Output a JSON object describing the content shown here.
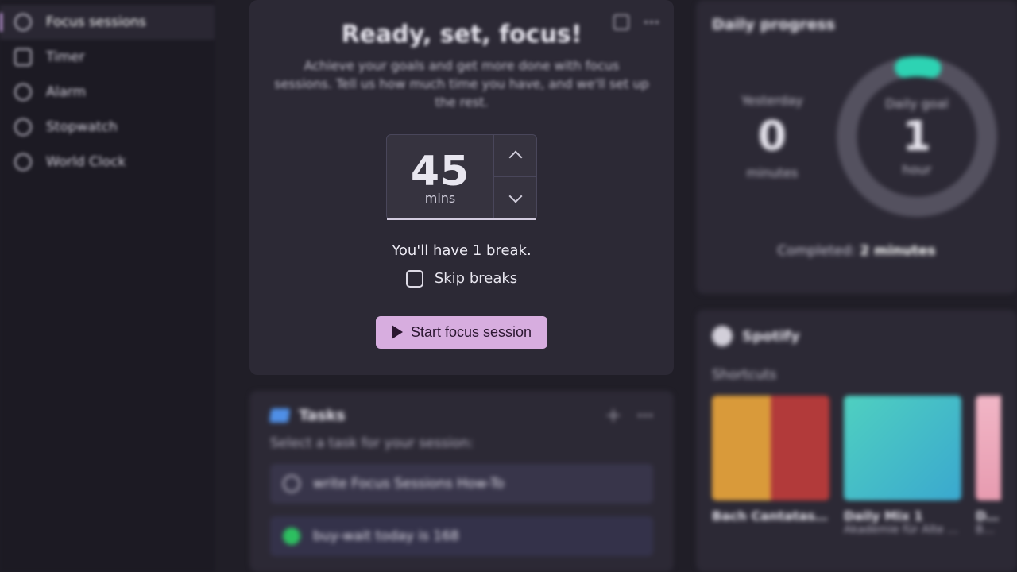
{
  "nav": {
    "items": [
      {
        "label": "Focus sessions",
        "icon": "focus"
      },
      {
        "label": "Timer",
        "icon": "timer"
      },
      {
        "label": "Alarm",
        "icon": "alarm"
      },
      {
        "label": "Stopwatch",
        "icon": "stopwatch"
      },
      {
        "label": "World Clock",
        "icon": "world-clock"
      }
    ]
  },
  "focus": {
    "title": "Ready, set, focus!",
    "subtitle": "Achieve your goals and get more done with focus sessions. Tell us how much time you have, and we'll set up the rest.",
    "duration_value": "45",
    "duration_unit": "mins",
    "break_line": "You'll have 1 break.",
    "skip_label": "Skip breaks",
    "start_label": "Start focus session"
  },
  "tasks": {
    "title": "Tasks",
    "prompt": "Select a task for your session:",
    "items": [
      {
        "label": "write Focus Sessions How-To",
        "done": false
      },
      {
        "label": "buy-wait today is 168",
        "done": true
      }
    ]
  },
  "progress": {
    "title": "Daily progress",
    "yesterday_label": "Yesterday",
    "yesterday_value": "0",
    "yesterday_unit": "minutes",
    "goal_label": "Daily goal",
    "goal_value": "1",
    "goal_unit": "hour",
    "completed_label": "Completed:",
    "completed_value": "2 minutes",
    "ring_percent": 6
  },
  "spotify": {
    "title": "Spotify",
    "shortcuts_label": "Shortcuts",
    "albums": [
      {
        "title": "Bach Cantatas —",
        "sub": ""
      },
      {
        "title": "Daily Mix 1",
        "sub": "Akademie für Alte Musik Berlin…"
      },
      {
        "title": "Daily",
        "sub": "Bath… Stage…"
      }
    ]
  },
  "colors": {
    "accent": "#d7addf",
    "ring": "#2dd3b3"
  }
}
